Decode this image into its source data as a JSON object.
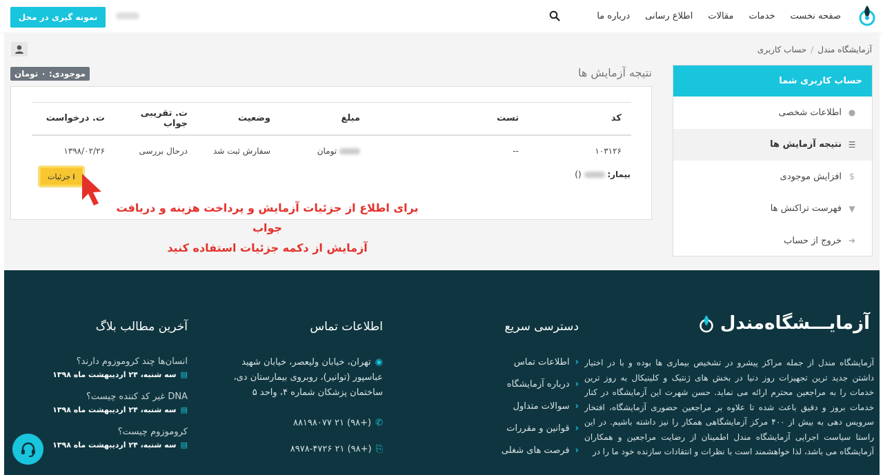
{
  "header": {
    "nav": [
      "صفحه نخست",
      "خدمات",
      "مقالات",
      "اطلاع رسانی",
      "درباره ما"
    ],
    "cta_label": "نمونه گیری در محل"
  },
  "breadcrumb": [
    "آزمایشگاه مندل",
    "حساب کاربری"
  ],
  "main": {
    "title": "نتیجه آزمایش ها",
    "balance": "موجودی: ۰ تومان",
    "table": {
      "headers": [
        "کد",
        "تست",
        "مبلغ",
        "وضعیت",
        "ت. تقریبی جواب",
        "ت. درخواست"
      ],
      "row": {
        "code": "۱۰۳۱۲۶",
        "test": "--",
        "amount_suffix": "تومان",
        "status": "سفارش ثبت شد",
        "approx": "درحال بررسی",
        "date": "۱۳۹۸/۰۲/۲۶"
      }
    },
    "patient_label": "بیمار:",
    "patient_suffix": "()",
    "details_label": "جزئیات",
    "note_line1": "برای اطلاع از جزئیات آزمایش و پرداخت هزینه و دریافت جواب",
    "note_line2": "آزمایش از دکمه جزئیات استفاده کنید"
  },
  "sidebar": {
    "title": "حساب کاربری شما",
    "items": [
      {
        "label": "اطلاعات شخصی",
        "icon": "user-icon"
      },
      {
        "label": "نتیجه آزمایش ها",
        "icon": "list-icon"
      },
      {
        "label": "افزایش موجودی",
        "icon": "dollar-icon"
      },
      {
        "label": "فهرست تراکنش ها",
        "icon": "filter-icon"
      },
      {
        "label": "خروج از حساب",
        "icon": "logout-icon"
      }
    ]
  },
  "footer": {
    "logo_text": "آزمایـــشگاه‌مندل",
    "about": "آزمایشگاه مندل از جمله مراکز پیشرو در تشخیص بیماری ها بوده و با در اختیار داشتن جدید ترین تجهیزات روز دنیا در بخش های ژنتیک و کلینیکال به روز ترین خدمات را به مراجعین محترم ارائه می نماید. حسن شهرت این آزمایشگاه در کنار خدمات بروز و دقیق باعث شده تا علاوه بر مراجعین حضوری آزمایشگاه، افتخار سرویس دهی به بیش از ۴۰۰ مرکز آزمایشگاهی همکار را نیز داشته باشیم. در این راستا سیاست اجرایی آزمایشگاه مندل اطمینان از رضایت مراجعین و همکاران آزمایشگاه می باشد، لذا خواهشمند است با نظرات و انتقادات سازنده خود ما را در",
    "quick_title": "دسترسی سریع",
    "quick_links": [
      "اطلاعات تماس",
      "درباره آزمایشگاه",
      "سوالات متداول",
      "قوانین و مقررات",
      "فرصت های شغلی"
    ],
    "contact_title": "اطلاعات تماس",
    "address": "تهران، خیابان ولیعصر، خیابان شهید عباسپور (توانیر)، روبروی بیمارستان دی، ساختمان پزشکان شماره ۴، واحد ۵",
    "phone": "(+۹۸) ۲۱ ۸۸۱۹۸۰۷۷",
    "fax": "(+۹۸) ۲۱ ۸۹۷۸-۴۷۲۶",
    "blog_title": "آخرین مطالب بلاگ",
    "blog": [
      {
        "q": "انسان‌ها چند کروموزوم دارند؟",
        "date": "سه شنبه، ۲۴ اردیبهشت ماه ۱۳۹۸"
      },
      {
        "q": "DNA غیر کد کننده چیست؟",
        "date": "سه شنبه، ۲۴ اردیبهشت ماه ۱۳۹۸"
      },
      {
        "q": "کروموزوم چیست؟",
        "date": "سه شنبه، ۲۴ اردیبهشت ماه ۱۳۹۸"
      }
    ]
  }
}
